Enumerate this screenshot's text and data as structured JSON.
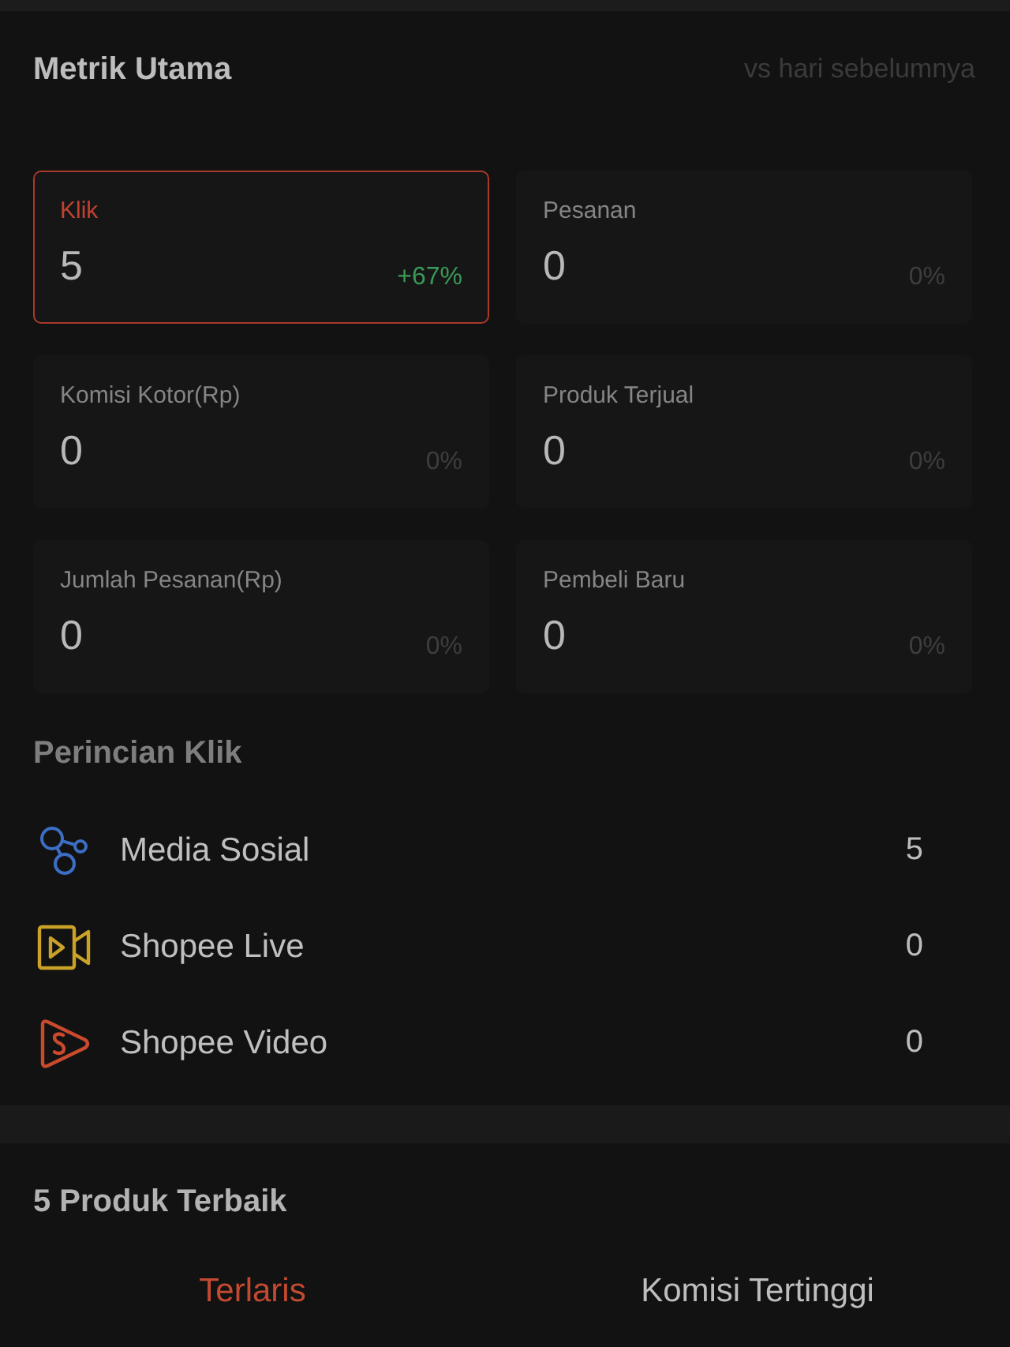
{
  "header": {
    "title": "Metrik Utama",
    "comparison": "vs hari sebelumnya"
  },
  "metrics": [
    {
      "label": "Klik",
      "value": "5",
      "change": "+67%",
      "kind": "increase",
      "selected": true
    },
    {
      "label": "Pesanan",
      "value": "0",
      "change": "0%",
      "kind": "unchanged",
      "selected": false
    },
    {
      "label": "Komisi Kotor(Rp)",
      "value": "0",
      "change": "0%",
      "kind": "unchanged",
      "selected": false
    },
    {
      "label": "Produk Terjual",
      "value": "0",
      "change": "0%",
      "kind": "unchanged",
      "selected": false
    },
    {
      "label": "Jumlah Pesanan(Rp)",
      "value": "0",
      "change": "0%",
      "kind": "unchanged",
      "selected": false
    },
    {
      "label": "Pembeli Baru",
      "value": "0",
      "change": "0%",
      "kind": "unchanged",
      "selected": false
    }
  ],
  "click_breakdown": {
    "title": "Perincian Klik",
    "rows": [
      {
        "kind": "social",
        "label": "Media Sosial",
        "value": "5"
      },
      {
        "kind": "live",
        "label": "Shopee Live",
        "value": "0"
      },
      {
        "kind": "video",
        "label": "Shopee Video",
        "value": "0"
      }
    ]
  },
  "top_products": {
    "title": "5 Produk Terbaik",
    "tabs": [
      {
        "label": "Terlaris",
        "selected": true
      },
      {
        "label": "Komisi Tertinggi",
        "selected": false
      }
    ]
  }
}
